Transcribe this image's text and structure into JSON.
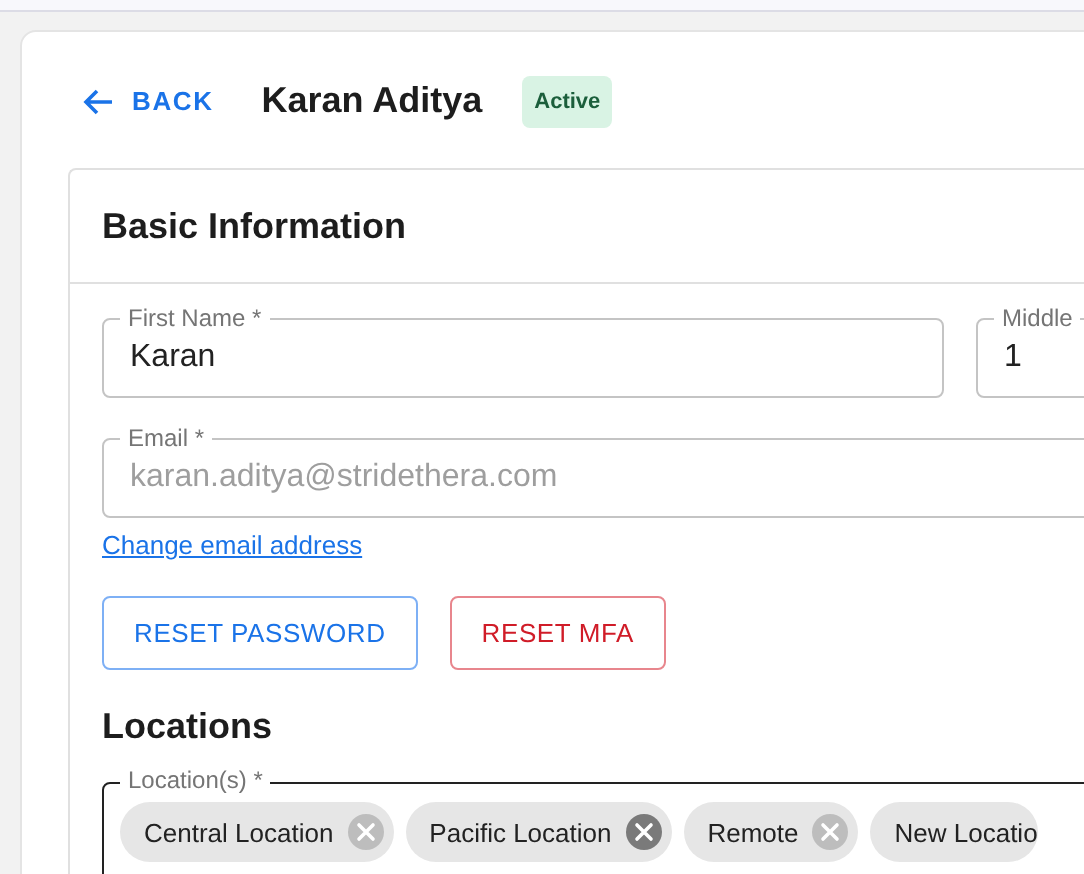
{
  "header": {
    "back": "BACK",
    "title": "Karan Aditya",
    "status": "Active"
  },
  "basic_information": {
    "heading": "Basic Information",
    "fields": [
      {
        "label": "First Name *",
        "value": "Karan",
        "disabled": false
      },
      {
        "label": "Middle",
        "value": "1",
        "disabled": false
      }
    ],
    "email": {
      "label": "Email *",
      "value": "karan.aditya@stridethera.com",
      "disabled": true
    },
    "change_email_link": "Change email address",
    "buttons": [
      {
        "label": "RESET PASSWORD",
        "kind": "primary"
      },
      {
        "label": "RESET MFA",
        "kind": "danger"
      }
    ]
  },
  "locations": {
    "heading": "Locations",
    "label": "Location(s) *",
    "focused": true,
    "chips": [
      {
        "label": "Central Location",
        "highlighted": false
      },
      {
        "label": "Pacific Location",
        "highlighted": true
      },
      {
        "label": "Remote",
        "highlighted": false
      },
      {
        "label": "New Locatio"
      }
    ]
  }
}
